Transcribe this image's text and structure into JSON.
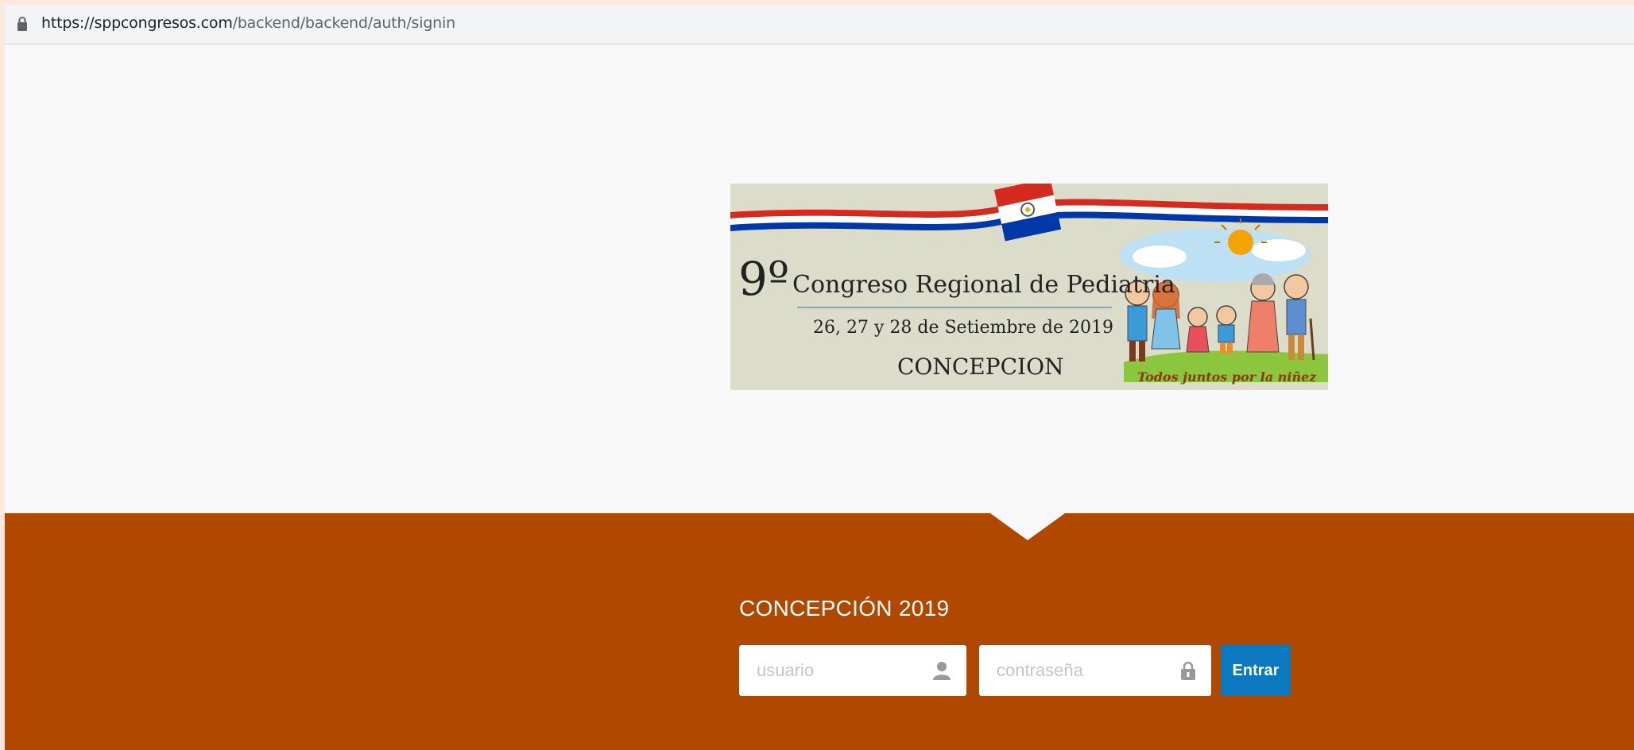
{
  "browser": {
    "url_host": "https://sppcongresos.com",
    "url_path": "/backend/backend/auth/signin"
  },
  "banner": {
    "number": "9º",
    "title": "Congreso Regional de Pediatria",
    "dates": "26, 27 y 28 de Setiembre de 2019",
    "city": "CONCEPCION",
    "slogan": "Todos juntos por la niñez"
  },
  "login": {
    "title": "CONCEPCIÓN 2019",
    "username_placeholder": "usuario",
    "password_placeholder": "contraseña",
    "submit_label": "Entrar"
  },
  "colors": {
    "accent": "#b04800",
    "button": "#0b78bf",
    "background": "#f8f8f8"
  },
  "icons": {
    "lock": "lock-icon",
    "user": "user-icon",
    "password": "padlock-icon"
  }
}
